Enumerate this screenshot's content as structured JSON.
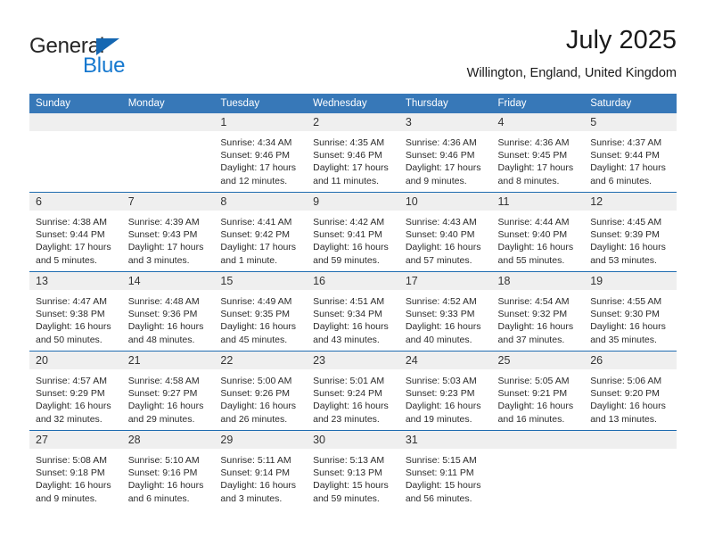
{
  "brand": {
    "name_primary": "General",
    "name_secondary": "Blue",
    "triangle_icon": "triangle-icon",
    "accent_color": "#1578cf",
    "header_color": "#3778b8"
  },
  "header": {
    "title": "July 2025",
    "subtitle": "Willington, England, United Kingdom"
  },
  "weekday_headers": [
    "Sunday",
    "Monday",
    "Tuesday",
    "Wednesday",
    "Thursday",
    "Friday",
    "Saturday"
  ],
  "weeks": [
    [
      {
        "day": "",
        "l1": "",
        "l2": "",
        "l3": "",
        "l4": "",
        "empty": true
      },
      {
        "day": "",
        "l1": "",
        "l2": "",
        "l3": "",
        "l4": "",
        "empty": true
      },
      {
        "day": "1",
        "l1": "Sunrise: 4:34 AM",
        "l2": "Sunset: 9:46 PM",
        "l3": "Daylight: 17 hours",
        "l4": "and 12 minutes."
      },
      {
        "day": "2",
        "l1": "Sunrise: 4:35 AM",
        "l2": "Sunset: 9:46 PM",
        "l3": "Daylight: 17 hours",
        "l4": "and 11 minutes."
      },
      {
        "day": "3",
        "l1": "Sunrise: 4:36 AM",
        "l2": "Sunset: 9:46 PM",
        "l3": "Daylight: 17 hours",
        "l4": "and 9 minutes."
      },
      {
        "day": "4",
        "l1": "Sunrise: 4:36 AM",
        "l2": "Sunset: 9:45 PM",
        "l3": "Daylight: 17 hours",
        "l4": "and 8 minutes."
      },
      {
        "day": "5",
        "l1": "Sunrise: 4:37 AM",
        "l2": "Sunset: 9:44 PM",
        "l3": "Daylight: 17 hours",
        "l4": "and 6 minutes."
      }
    ],
    [
      {
        "day": "6",
        "l1": "Sunrise: 4:38 AM",
        "l2": "Sunset: 9:44 PM",
        "l3": "Daylight: 17 hours",
        "l4": "and 5 minutes."
      },
      {
        "day": "7",
        "l1": "Sunrise: 4:39 AM",
        "l2": "Sunset: 9:43 PM",
        "l3": "Daylight: 17 hours",
        "l4": "and 3 minutes."
      },
      {
        "day": "8",
        "l1": "Sunrise: 4:41 AM",
        "l2": "Sunset: 9:42 PM",
        "l3": "Daylight: 17 hours",
        "l4": "and 1 minute."
      },
      {
        "day": "9",
        "l1": "Sunrise: 4:42 AM",
        "l2": "Sunset: 9:41 PM",
        "l3": "Daylight: 16 hours",
        "l4": "and 59 minutes."
      },
      {
        "day": "10",
        "l1": "Sunrise: 4:43 AM",
        "l2": "Sunset: 9:40 PM",
        "l3": "Daylight: 16 hours",
        "l4": "and 57 minutes."
      },
      {
        "day": "11",
        "l1": "Sunrise: 4:44 AM",
        "l2": "Sunset: 9:40 PM",
        "l3": "Daylight: 16 hours",
        "l4": "and 55 minutes."
      },
      {
        "day": "12",
        "l1": "Sunrise: 4:45 AM",
        "l2": "Sunset: 9:39 PM",
        "l3": "Daylight: 16 hours",
        "l4": "and 53 minutes."
      }
    ],
    [
      {
        "day": "13",
        "l1": "Sunrise: 4:47 AM",
        "l2": "Sunset: 9:38 PM",
        "l3": "Daylight: 16 hours",
        "l4": "and 50 minutes."
      },
      {
        "day": "14",
        "l1": "Sunrise: 4:48 AM",
        "l2": "Sunset: 9:36 PM",
        "l3": "Daylight: 16 hours",
        "l4": "and 48 minutes."
      },
      {
        "day": "15",
        "l1": "Sunrise: 4:49 AM",
        "l2": "Sunset: 9:35 PM",
        "l3": "Daylight: 16 hours",
        "l4": "and 45 minutes."
      },
      {
        "day": "16",
        "l1": "Sunrise: 4:51 AM",
        "l2": "Sunset: 9:34 PM",
        "l3": "Daylight: 16 hours",
        "l4": "and 43 minutes."
      },
      {
        "day": "17",
        "l1": "Sunrise: 4:52 AM",
        "l2": "Sunset: 9:33 PM",
        "l3": "Daylight: 16 hours",
        "l4": "and 40 minutes."
      },
      {
        "day": "18",
        "l1": "Sunrise: 4:54 AM",
        "l2": "Sunset: 9:32 PM",
        "l3": "Daylight: 16 hours",
        "l4": "and 37 minutes."
      },
      {
        "day": "19",
        "l1": "Sunrise: 4:55 AM",
        "l2": "Sunset: 9:30 PM",
        "l3": "Daylight: 16 hours",
        "l4": "and 35 minutes."
      }
    ],
    [
      {
        "day": "20",
        "l1": "Sunrise: 4:57 AM",
        "l2": "Sunset: 9:29 PM",
        "l3": "Daylight: 16 hours",
        "l4": "and 32 minutes."
      },
      {
        "day": "21",
        "l1": "Sunrise: 4:58 AM",
        "l2": "Sunset: 9:27 PM",
        "l3": "Daylight: 16 hours",
        "l4": "and 29 minutes."
      },
      {
        "day": "22",
        "l1": "Sunrise: 5:00 AM",
        "l2": "Sunset: 9:26 PM",
        "l3": "Daylight: 16 hours",
        "l4": "and 26 minutes."
      },
      {
        "day": "23",
        "l1": "Sunrise: 5:01 AM",
        "l2": "Sunset: 9:24 PM",
        "l3": "Daylight: 16 hours",
        "l4": "and 23 minutes."
      },
      {
        "day": "24",
        "l1": "Sunrise: 5:03 AM",
        "l2": "Sunset: 9:23 PM",
        "l3": "Daylight: 16 hours",
        "l4": "and 19 minutes."
      },
      {
        "day": "25",
        "l1": "Sunrise: 5:05 AM",
        "l2": "Sunset: 9:21 PM",
        "l3": "Daylight: 16 hours",
        "l4": "and 16 minutes."
      },
      {
        "day": "26",
        "l1": "Sunrise: 5:06 AM",
        "l2": "Sunset: 9:20 PM",
        "l3": "Daylight: 16 hours",
        "l4": "and 13 minutes."
      }
    ],
    [
      {
        "day": "27",
        "l1": "Sunrise: 5:08 AM",
        "l2": "Sunset: 9:18 PM",
        "l3": "Daylight: 16 hours",
        "l4": "and 9 minutes."
      },
      {
        "day": "28",
        "l1": "Sunrise: 5:10 AM",
        "l2": "Sunset: 9:16 PM",
        "l3": "Daylight: 16 hours",
        "l4": "and 6 minutes."
      },
      {
        "day": "29",
        "l1": "Sunrise: 5:11 AM",
        "l2": "Sunset: 9:14 PM",
        "l3": "Daylight: 16 hours",
        "l4": "and 3 minutes."
      },
      {
        "day": "30",
        "l1": "Sunrise: 5:13 AM",
        "l2": "Sunset: 9:13 PM",
        "l3": "Daylight: 15 hours",
        "l4": "and 59 minutes."
      },
      {
        "day": "31",
        "l1": "Sunrise: 5:15 AM",
        "l2": "Sunset: 9:11 PM",
        "l3": "Daylight: 15 hours",
        "l4": "and 56 minutes."
      },
      {
        "day": "",
        "l1": "",
        "l2": "",
        "l3": "",
        "l4": "",
        "empty": true
      },
      {
        "day": "",
        "l1": "",
        "l2": "",
        "l3": "",
        "l4": "",
        "empty": true
      }
    ]
  ]
}
